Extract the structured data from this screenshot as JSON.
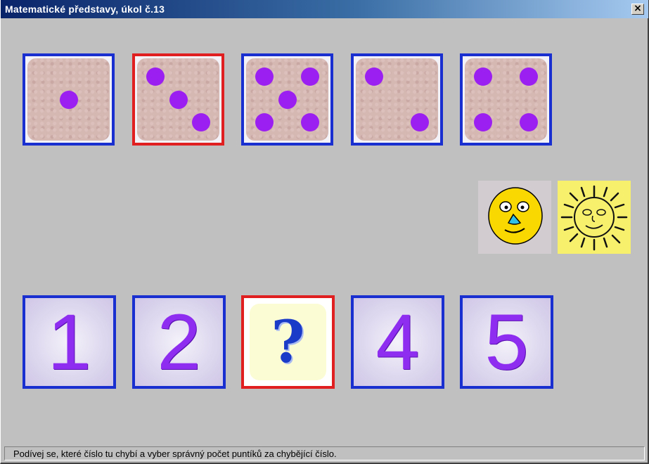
{
  "window": {
    "title": "Matematické představy, úkol č.13",
    "close_label": "×"
  },
  "dice": [
    {
      "value": 1,
      "selected": false
    },
    {
      "value": 3,
      "selected": true
    },
    {
      "value": 5,
      "selected": false
    },
    {
      "value": 2,
      "selected": false
    },
    {
      "value": 4,
      "selected": false
    }
  ],
  "numbers": [
    {
      "label": "1",
      "selected": false
    },
    {
      "label": "2",
      "selected": false
    },
    {
      "label": "?",
      "selected": true
    },
    {
      "label": "4",
      "selected": false
    },
    {
      "label": "5",
      "selected": false
    }
  ],
  "icons": {
    "smiley": "smiley-face-icon",
    "sun": "sun-icon"
  },
  "colors": {
    "tile_border": "#1a2fd0",
    "selected_border": "#e02020",
    "pip": "#9b1ff0",
    "digit": "#8e2cf0"
  },
  "status": {
    "text": "Podívej se, které číslo tu chybí a vyber správný počet puntíků za chybějící číslo."
  }
}
